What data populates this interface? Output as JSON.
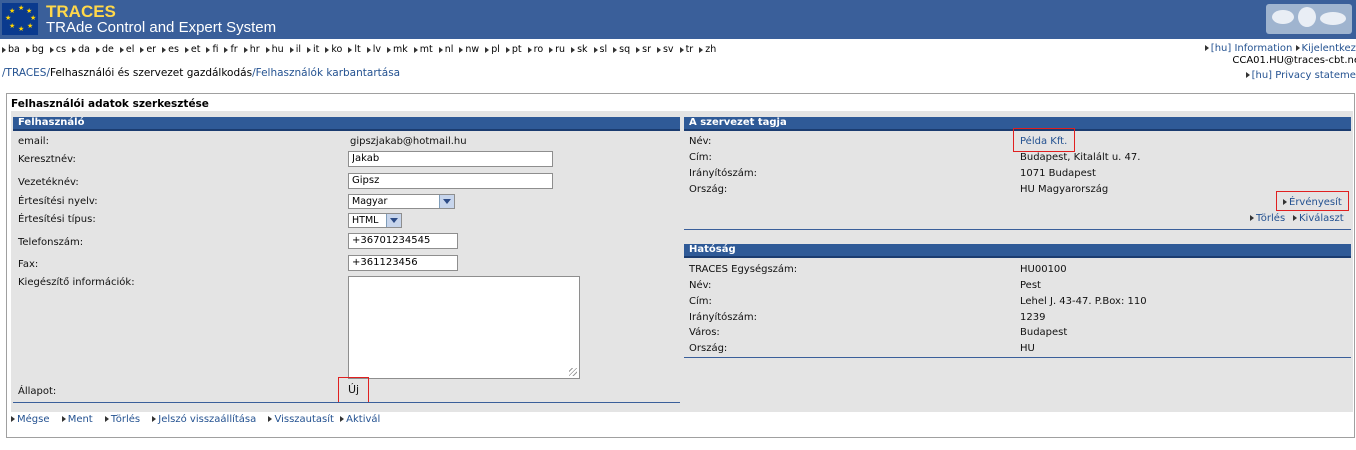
{
  "app": {
    "title": "TRACES",
    "subtitle": "TRAde Control and Expert System"
  },
  "languages": [
    "ba",
    "bg",
    "cs",
    "da",
    "de",
    "el",
    "er",
    "es",
    "et",
    "fi",
    "fr",
    "hr",
    "hu",
    "il",
    "it",
    "ko",
    "lt",
    "lv",
    "mk",
    "mt",
    "nl",
    "nw",
    "pl",
    "pt",
    "ro",
    "ru",
    "sk",
    "sl",
    "sq",
    "sr",
    "sv",
    "tr",
    "zh"
  ],
  "topright": {
    "lang": "[hu]",
    "information": "Information",
    "logout": "Kijelentkezé",
    "user": "CCA01.HU@traces-cbt.ne",
    "privacy_lang": "[hu]",
    "privacy": "Privacy statemer"
  },
  "breadcrumb": {
    "root": "/TRACES/",
    "section": "Felhasználói és szervezet gazdálkodás",
    "sep": "/",
    "page": "Felhasználók karbantartása"
  },
  "page_title": "Felhasználói adatok szerkesztése",
  "user_panel": {
    "heading": "Felhasználó",
    "email_label": "email:",
    "email_value": "gipszjakab@hotmail.hu",
    "firstname_label": "Keresztnév:",
    "firstname_value": "Jakab",
    "lastname_label": "Vezetéknév:",
    "lastname_value": "Gipsz",
    "notif_lang_label": "Értesítési nyelv:",
    "notif_lang_value": "Magyar",
    "notif_type_label": "Értesítési típus:",
    "notif_type_value": "HTML",
    "phone_label": "Telefonszám:",
    "phone_value": "+36701234545",
    "fax_label": "Fax:",
    "fax_value": "+361123456",
    "extra_label": "Kiegészítő információk:",
    "extra_value": "",
    "status_label": "Állapot:",
    "status_value": "Új"
  },
  "org_panel": {
    "heading": "A szervezet tagja",
    "name_label": "Név:",
    "name_value": "Példa Kft.",
    "address_label": "Cím:",
    "address_value": "Budapest, Kitalált u. 47.",
    "zip_label": "Irányítószám:",
    "zip_value": "1071 Budapest",
    "country_label": "Ország:",
    "country_value": "HU Magyarország",
    "validate_link": "Érvényesít",
    "delete_link": "Törlés",
    "select_link": "Kiválaszt"
  },
  "authority_panel": {
    "heading": "Hatóság",
    "unit_label": "TRACES Egységszám:",
    "unit_value": "HU00100",
    "name_label": "Név:",
    "name_value": "Pest",
    "address_label": "Cím:",
    "address_value": "Lehel J. 43-47. P.Box: 110",
    "zip_label": "Irányítószám:",
    "zip_value": "1239",
    "city_label": "Város:",
    "city_value": "Budapest",
    "country_label": "Ország:",
    "country_value": "HU"
  },
  "actions": {
    "cancel": "Mégse",
    "save": "Ment",
    "delete": "Törlés",
    "reset_password": "Jelszó visszaállítása",
    "reject": "Visszautasít",
    "activate": "Aktivál"
  },
  "colors": {
    "header_bg": "#3a5f9a",
    "panel_head": "#2f5a97",
    "link": "#245291",
    "highlight": "#e02020"
  }
}
